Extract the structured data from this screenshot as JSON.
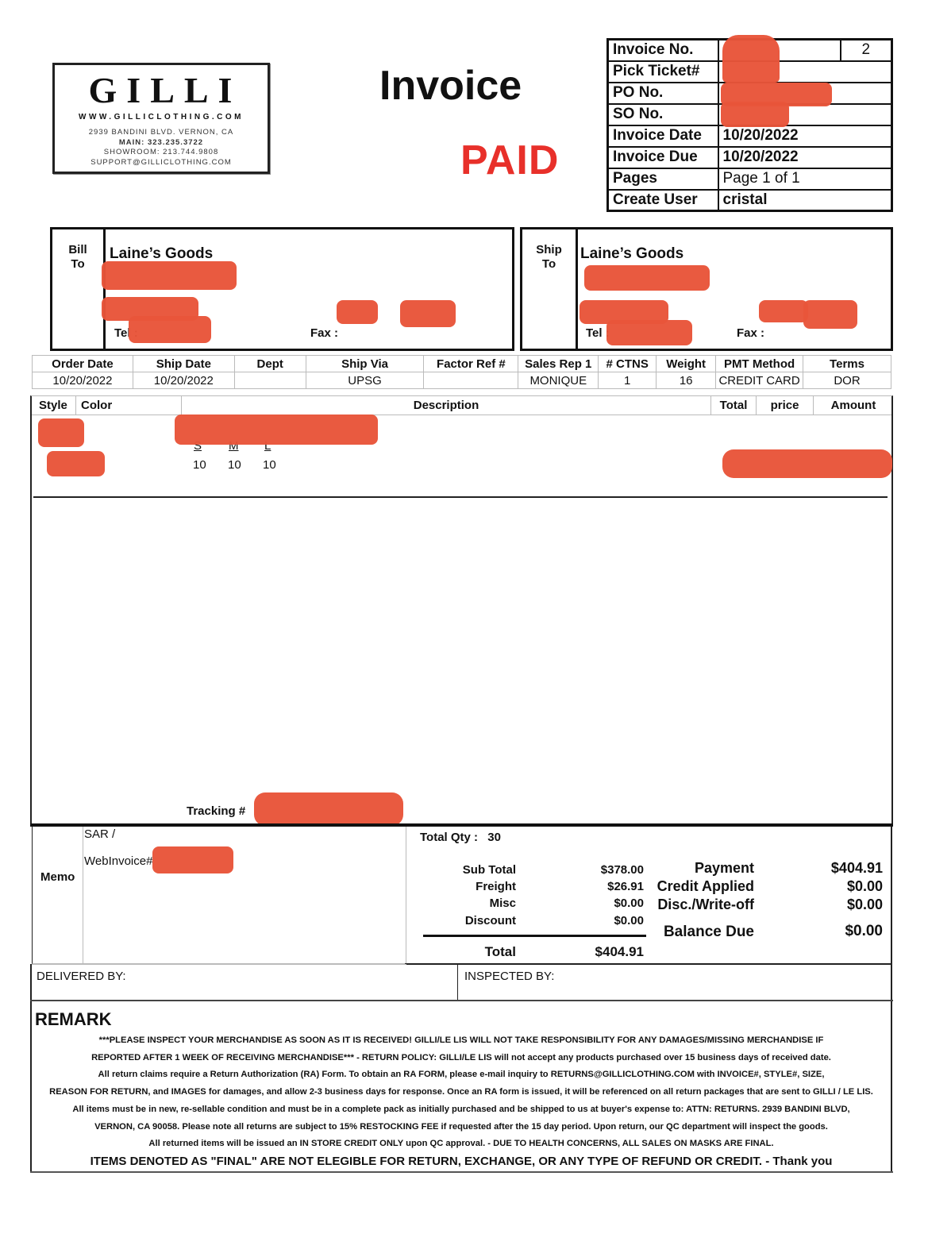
{
  "company": {
    "brand": "GILLI",
    "website": "WWW.GILLICLOTHING.COM",
    "address": "2939 BANDINI BLVD. VERNON, CA",
    "main_phone": "MAIN: 323.235.3722",
    "showroom_phone": "SHOWROOM: 213.744.9808",
    "support_email": "SUPPORT@GILLICLOTHING.COM"
  },
  "document": {
    "title": "Invoice",
    "status_stamp": "PAID",
    "colors": {
      "stamp": "#e8302a",
      "redaction": "#e8553a"
    }
  },
  "invoice_info": {
    "rows": [
      {
        "label": "Invoice No.",
        "value": "[redacted]",
        "extra": "2"
      },
      {
        "label": "Pick Ticket#",
        "value": "[redacted]"
      },
      {
        "label": "PO No.",
        "value": "[redacted]"
      },
      {
        "label": "SO No.",
        "value": "[redacted]"
      },
      {
        "label": "Invoice Date",
        "value": "10/20/2022"
      },
      {
        "label": "Invoice Due",
        "value": "10/20/2022"
      },
      {
        "label": "Pages",
        "value": "Page 1 of 1"
      },
      {
        "label": "Create User",
        "value": "cristal"
      }
    ]
  },
  "bill_to": {
    "label_line1": "Bill",
    "label_line2": "To",
    "name": "Laine’s Goods",
    "tel_label": "Tel :",
    "fax_label": "Fax :"
  },
  "ship_to": {
    "label_line1": "Ship",
    "label_line2": "To",
    "name": "Laine’s Goods",
    "tel_label": "Tel :",
    "fax_label": "Fax :"
  },
  "order_info": {
    "headers": [
      "Order Date",
      "Ship Date",
      "Dept",
      "Ship Via",
      "Factor Ref #",
      "Sales Rep 1",
      "# CTNS",
      "Weight",
      "PMT Method",
      "Terms"
    ],
    "values": [
      "10/20/2022",
      "10/20/2022",
      "",
      "UPSG",
      "",
      "MONIQUE",
      "1",
      "16",
      "CREDIT CARD",
      "DOR"
    ]
  },
  "line_items": {
    "headers": {
      "style": "Style",
      "color": "Color",
      "description": "Description",
      "total": "Total",
      "price": "price",
      "amount": "Amount"
    },
    "items": [
      {
        "style": "[redacted]",
        "color": "[redacted]",
        "description": "[redacted]",
        "sizes": [
          "S",
          "M",
          "L"
        ],
        "quantities": [
          "10",
          "10",
          "10"
        ],
        "amount": "[redacted]"
      }
    ],
    "tracking_label": "Tracking #"
  },
  "memo": {
    "label": "Memo",
    "line1": "SAR /",
    "line2": "WebInvoice#"
  },
  "summary": {
    "total_qty_label": "Total Qty :",
    "total_qty": "30",
    "rows": [
      {
        "label": "Sub Total",
        "value": "$378.00"
      },
      {
        "label": "Freight",
        "value": "$26.91"
      },
      {
        "label": "Misc",
        "value": "$0.00"
      },
      {
        "label": "Discount",
        "value": "$0.00"
      }
    ],
    "total_label": "Total",
    "total": "$404.91"
  },
  "payment": {
    "rows": [
      {
        "label": "Payment",
        "value": "$404.91"
      },
      {
        "label": "Credit Applied",
        "value": "$0.00"
      },
      {
        "label": "Disc./Write-off",
        "value": "$0.00"
      }
    ],
    "balance_label": "Balance Due",
    "balance": "$0.00"
  },
  "signatures": {
    "delivered_by": "DELIVERED BY:",
    "inspected_by": "INSPECTED BY:"
  },
  "remark": {
    "title": "REMARK",
    "lines": [
      "***PLEASE INSPECT YOUR MERCHANDISE AS SOON AS IT IS RECEIVED! GILLI/LE LIS WILL NOT TAKE RESPONSIBILITY FOR ANY DAMAGES/MISSING MERCHANDISE IF",
      "REPORTED AFTER 1 WEEK OF RECEIVING MERCHANDISE*** - RETURN POLICY: GILLI/LE LIS will not accept any products purchased over 15 business days of received date.",
      "All return claims require a Return Authorization (RA) Form. To obtain an RA FORM, please e-mail inquiry to RETURNS@GILLICLOTHING.COM with INVOICE#, STYLE#, SIZE,",
      "REASON FOR RETURN, and IMAGES for damages, and allow 2-3 business days for response. Once an RA form is issued, it will be referenced on all return packages that are sent to GILLI / LE LIS.",
      "All items must be in new, re-sellable condition and must be in a complete pack as initially purchased and be shipped to us at buyer's expense to: ATTN: RETURNS. 2939 BANDINI BLVD,",
      "VERNON, CA 90058. Please note all returns are subject to 15% RESTOCKING FEE if requested after the 15 day period. Upon return, our QC department will inspect the goods.",
      "All returned items will be issued an IN STORE CREDIT ONLY upon QC approval. - DUE TO HEALTH CONCERNS, ALL SALES ON MASKS ARE FINAL."
    ],
    "final_line": "ITEMS DENOTED AS \"FINAL\" ARE NOT ELEGIBLE FOR RETURN, EXCHANGE, OR ANY TYPE OF REFUND OR CREDIT. - Thank you"
  }
}
